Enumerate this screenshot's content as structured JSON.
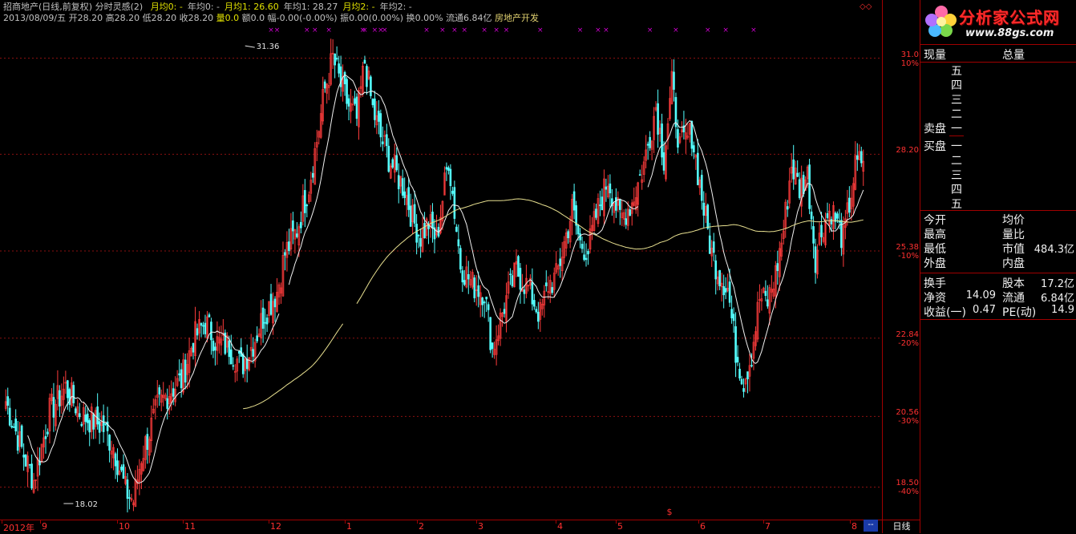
{
  "header": {
    "stock_name": "招商地产(日线,前复权)",
    "indicator_name": "分时灵感(2)",
    "ma_items": [
      {
        "label": "月均0:",
        "value": "-",
        "color": "#e0e000"
      },
      {
        "label": "年均0:",
        "value": "-",
        "color": "#c0c0c0"
      },
      {
        "label": "月均1:",
        "value": "26.60",
        "color": "#e0e000"
      },
      {
        "label": "年均1:",
        "value": "28.27",
        "color": "#c0c0c0"
      },
      {
        "label": "月均2:",
        "value": "-",
        "color": "#e0e000"
      },
      {
        "label": "年均2:",
        "value": "-",
        "color": "#c0c0c0"
      }
    ],
    "line2": {
      "date": "2013/08/09/五",
      "open": "开28.20",
      "high": "高28.20",
      "low": "低28.20",
      "close": "收28.20",
      "volume": "量0.0",
      "amount": "额0.0",
      "change": "幅-0.00(-0.00%)",
      "amplitude": "振0.00(0.00%)",
      "turnover": "换0.00%",
      "float": "流通6.84亿",
      "industry": "房地产开发"
    }
  },
  "price_axis": {
    "ticks": [
      {
        "price": "31.0",
        "pct": "10%",
        "v": 31.0
      },
      {
        "price": "28.20",
        "pct": "",
        "v": 28.2
      },
      {
        "price": "25.38",
        "pct": "-10%",
        "v": 25.38
      },
      {
        "price": "22.84",
        "pct": "-20%",
        "v": 22.84
      },
      {
        "price": "20.56",
        "pct": "-30%",
        "v": 20.56
      },
      {
        "price": "18.50",
        "pct": "-40%",
        "v": 18.5
      }
    ],
    "max": 31.36,
    "min": 18.02
  },
  "annotations": {
    "high_label": "31.36",
    "low_label": "18.02"
  },
  "time_axis": {
    "labels": [
      "2012年",
      "9",
      "10",
      "11",
      "12",
      "1",
      "2",
      "3",
      "4",
      "5",
      "6",
      "7",
      "8"
    ]
  },
  "tabs": {
    "daily": "日线",
    "corner": "--"
  },
  "logo": {
    "name": "分析家公式网",
    "url": "www.88gs.com"
  },
  "panel": {
    "current_vol": "现量",
    "total_vol": "总量",
    "sell_levels": [
      "五",
      "四",
      "三",
      "二",
      "一"
    ],
    "sell_label": "卖盘",
    "buy_label": "买盘",
    "buy_levels": [
      "一",
      "二",
      "三",
      "四",
      "五"
    ],
    "stats1": [
      {
        "k1": "今开",
        "v1": "",
        "k2": "均价",
        "v2": ""
      },
      {
        "k1": "最高",
        "v1": "",
        "k2": "量比",
        "v2": ""
      },
      {
        "k1": "最低",
        "v1": "",
        "k2": "市值",
        "v2": "484.3亿"
      },
      {
        "k1": "外盘",
        "v1": "",
        "k2": "内盘",
        "v2": ""
      }
    ],
    "stats2": [
      {
        "k1": "换手",
        "v1": "",
        "k2": "股本",
        "v2": "17.2亿"
      },
      {
        "k1": "净资",
        "v1": "14.09",
        "k2": "流通",
        "v2": "6.84亿"
      },
      {
        "k1": "收益(一)",
        "v1": "0.47",
        "k2": "PE(动)",
        "v2": "14.9"
      }
    ]
  },
  "colors": {
    "up": "#ff3c3c",
    "down": "#54ffff",
    "ma_short": "#f0f0f0",
    "ma_long": "#e8e090",
    "grid": "#8a1010",
    "marker": "#d000d0"
  },
  "chart_data": {
    "type": "candlestick",
    "anchors": [
      [
        0,
        21.0
      ],
      [
        8,
        19.6
      ],
      [
        14,
        18.7
      ],
      [
        22,
        20.7
      ],
      [
        30,
        21.4
      ],
      [
        38,
        20.6
      ],
      [
        48,
        20.3
      ],
      [
        54,
        19.7
      ],
      [
        60,
        18.4
      ],
      [
        64,
        18.1
      ],
      [
        68,
        19.4
      ],
      [
        76,
        20.8
      ],
      [
        82,
        21.3
      ],
      [
        88,
        21.6
      ],
      [
        94,
        22.8
      ],
      [
        100,
        23.3
      ],
      [
        106,
        22.7
      ],
      [
        112,
        22.6
      ],
      [
        118,
        22.0
      ],
      [
        124,
        22.7
      ],
      [
        130,
        23.6
      ],
      [
        136,
        24.2
      ],
      [
        140,
        25.3
      ],
      [
        146,
        26.0
      ],
      [
        152,
        27.3
      ],
      [
        156,
        28.6
      ],
      [
        160,
        30.1
      ],
      [
        164,
        31.0
      ],
      [
        168,
        30.2
      ],
      [
        172,
        29.6
      ],
      [
        176,
        29.2
      ],
      [
        180,
        30.9
      ],
      [
        184,
        29.5
      ],
      [
        188,
        28.7
      ],
      [
        192,
        28.1
      ],
      [
        196,
        27.6
      ],
      [
        200,
        27.2
      ],
      [
        204,
        26.3
      ],
      [
        208,
        25.8
      ],
      [
        212,
        26.2
      ],
      [
        216,
        25.7
      ],
      [
        222,
        28.1
      ],
      [
        228,
        25.0
      ],
      [
        234,
        24.4
      ],
      [
        240,
        24.2
      ],
      [
        244,
        22.5
      ],
      [
        250,
        23.8
      ],
      [
        256,
        24.8
      ],
      [
        262,
        24.3
      ],
      [
        268,
        23.5
      ],
      [
        272,
        24.4
      ],
      [
        276,
        24.6
      ],
      [
        280,
        25.6
      ],
      [
        284,
        26.6
      ],
      [
        288,
        25.6
      ],
      [
        292,
        25.4
      ],
      [
        296,
        26.4
      ],
      [
        302,
        27.5
      ],
      [
        308,
        26.3
      ],
      [
        314,
        26.8
      ],
      [
        320,
        27.9
      ],
      [
        326,
        29.6
      ],
      [
        330,
        28.1
      ],
      [
        334,
        30.2
      ],
      [
        338,
        28.4
      ],
      [
        344,
        28.8
      ],
      [
        350,
        26.6
      ],
      [
        354,
        25.3
      ],
      [
        358,
        24.7
      ],
      [
        362,
        24.3
      ],
      [
        366,
        22.5
      ],
      [
        370,
        21.6
      ],
      [
        374,
        22.4
      ],
      [
        378,
        24.0
      ],
      [
        382,
        23.9
      ],
      [
        386,
        24.7
      ],
      [
        390,
        26.0
      ],
      [
        394,
        27.9
      ],
      [
        398,
        27.2
      ],
      [
        402,
        27.6
      ],
      [
        406,
        25.2
      ],
      [
        410,
        26.2
      ],
      [
        414,
        26.6
      ],
      [
        420,
        25.7
      ],
      [
        426,
        27.8
      ],
      [
        430,
        28.1
      ]
    ],
    "n": 431,
    "ma_short_desc": "white moving average",
    "ma_long_desc": "yellow moving average"
  }
}
